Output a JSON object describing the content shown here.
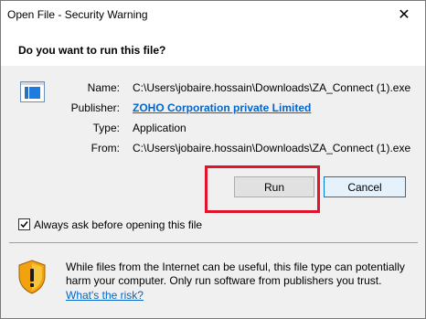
{
  "window": {
    "title": "Open File - Security Warning",
    "close_glyph": "✕"
  },
  "question": "Do you want to run this file?",
  "file_icon": "application-file-icon",
  "details": {
    "name_label": "Name:",
    "name_value": "C:\\Users\\jobaire.hossain\\Downloads\\ZA_Connect (1).exe",
    "publisher_label": "Publisher:",
    "publisher_value": "ZOHO Corporation private Limited",
    "type_label": "Type:",
    "type_value": "Application",
    "from_label": "From:",
    "from_value": "C:\\Users\\jobaire.hossain\\Downloads\\ZA_Connect (1).exe"
  },
  "buttons": {
    "run_label": "Run",
    "cancel_label": "Cancel"
  },
  "checkbox": {
    "label": "Always ask before opening this file",
    "checked": true
  },
  "warning": {
    "text": "While files from the Internet can be useful, this file type can potentially harm your computer. Only run software from publishers you trust.",
    "link_text": "What's the risk?"
  },
  "colors": {
    "highlight_box": "#e0152b",
    "link": "#0066cc",
    "cancel_border": "#0078d7"
  }
}
